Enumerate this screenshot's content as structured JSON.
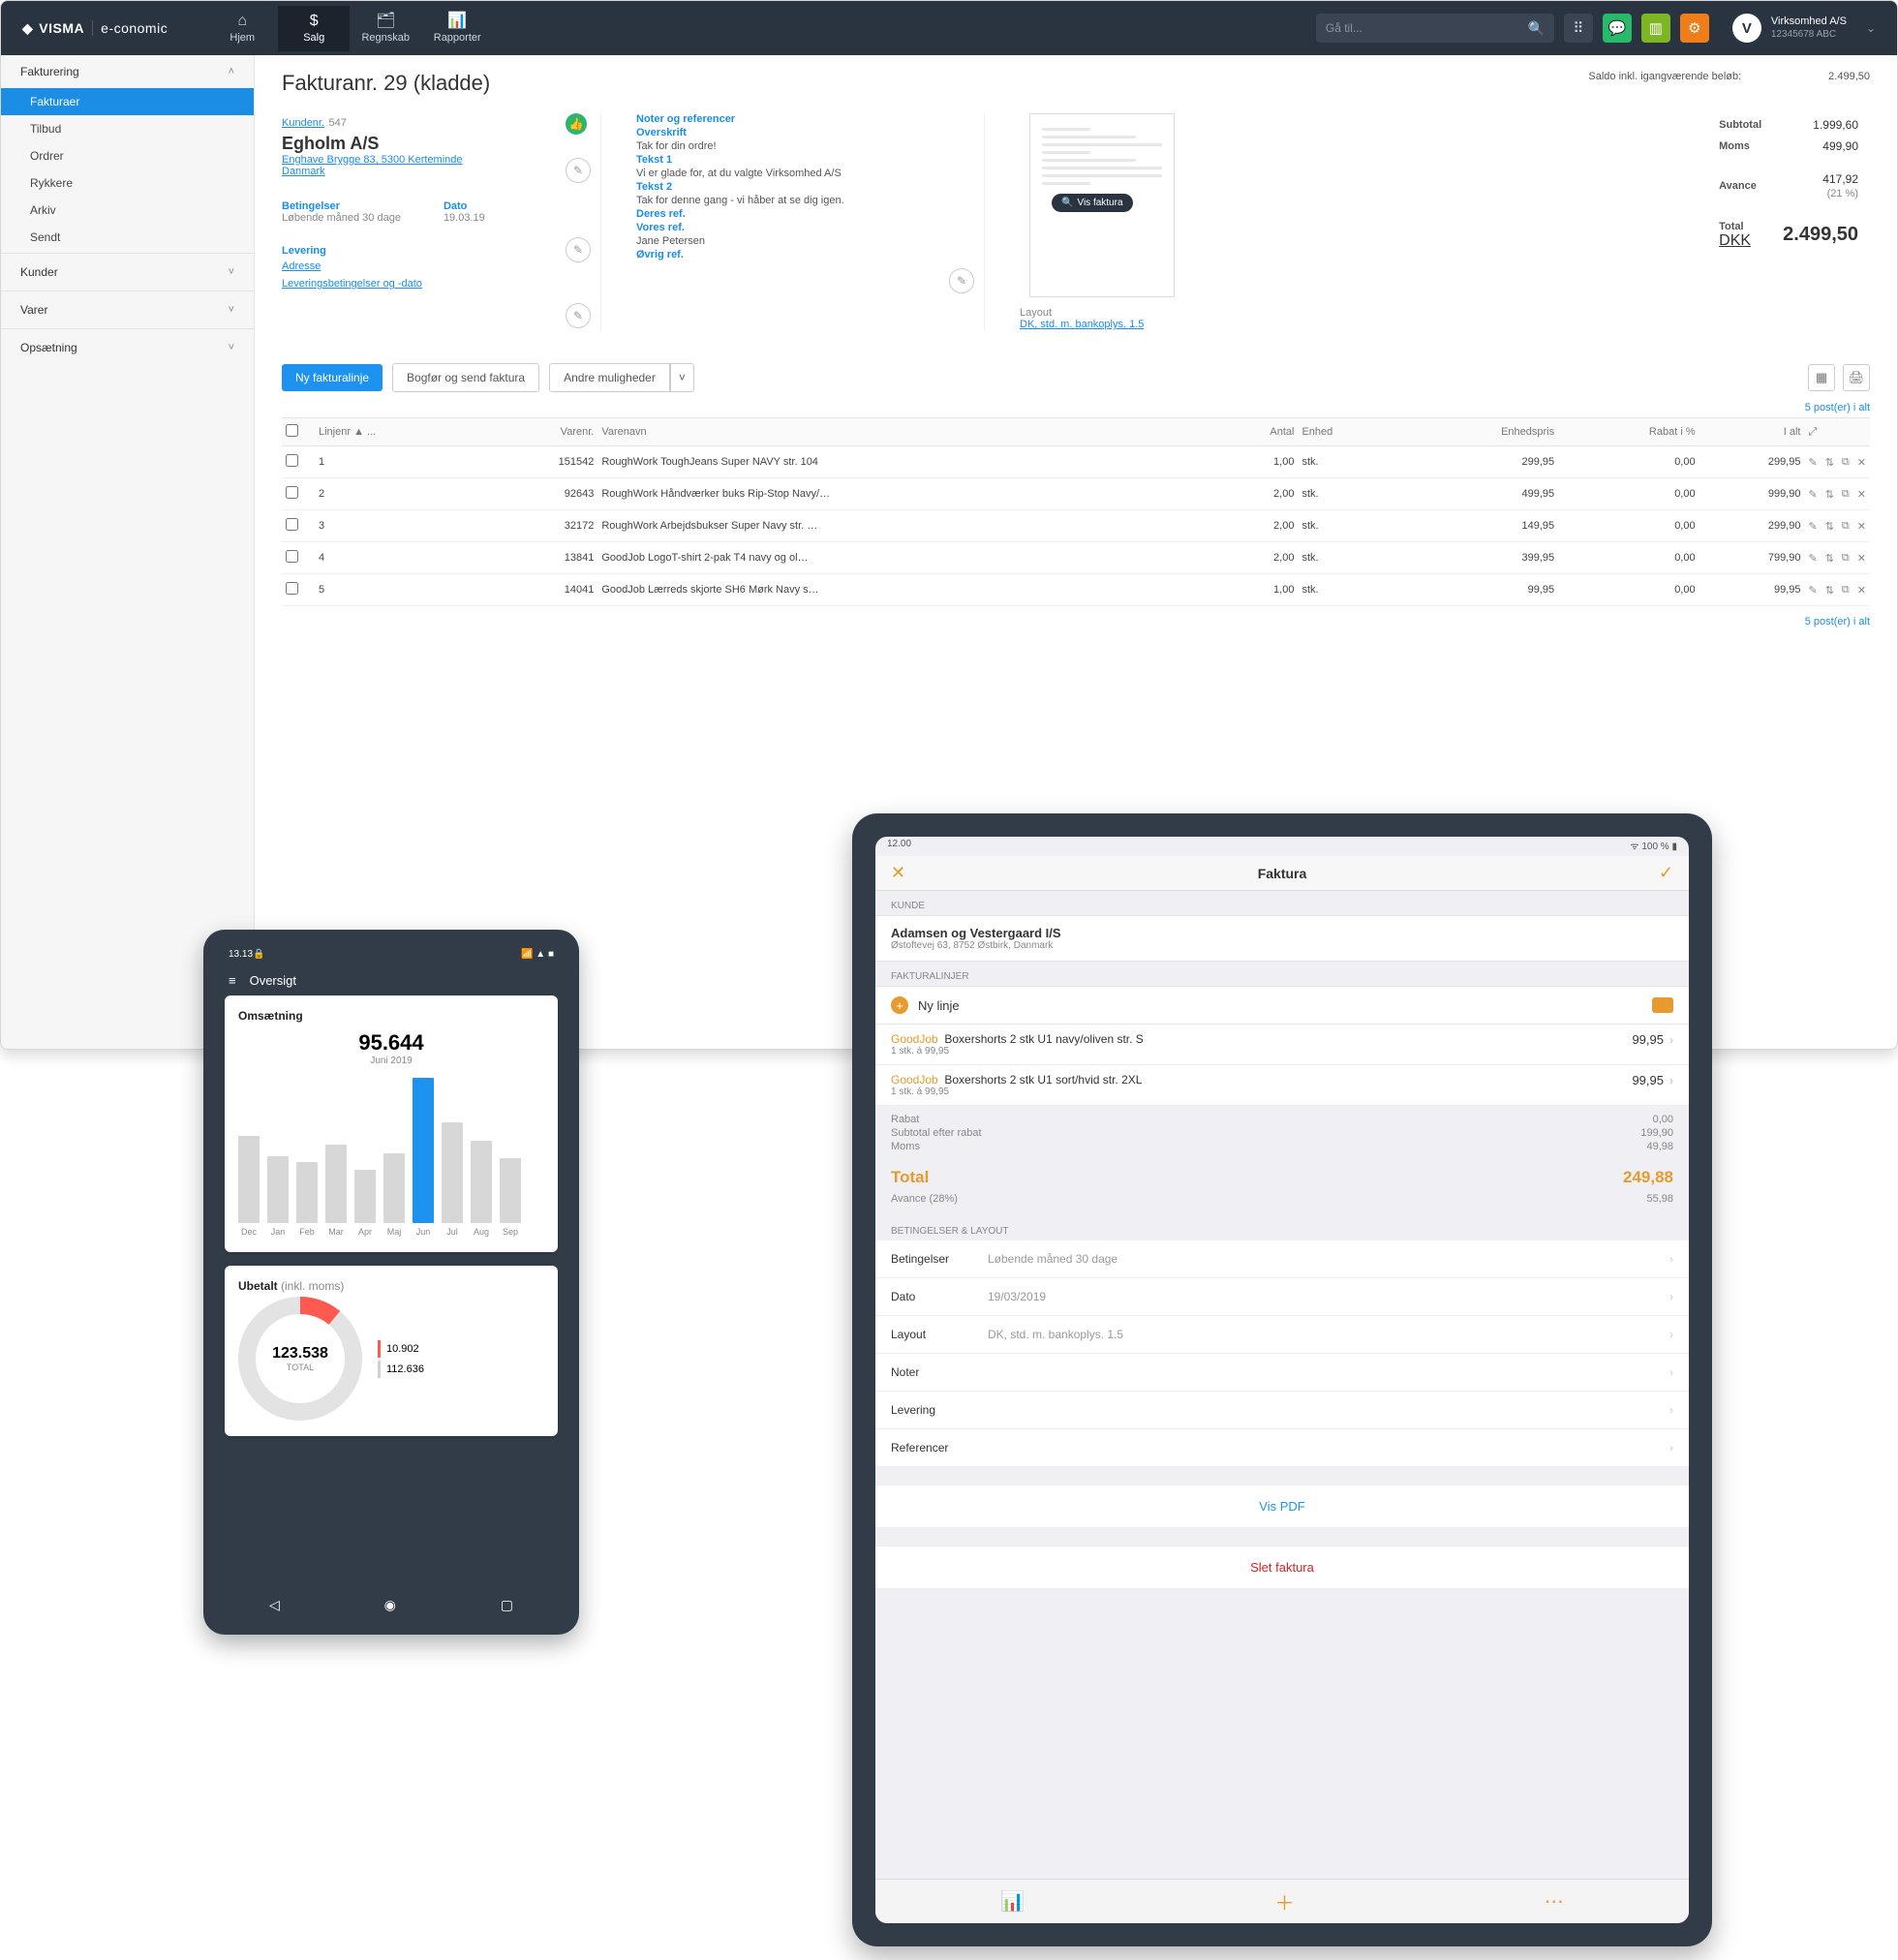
{
  "topbar": {
    "brand": "VISMA",
    "product": "e-conomic",
    "nav": [
      {
        "label": "Hjem",
        "icon": "⌂"
      },
      {
        "label": "Salg",
        "icon": "$"
      },
      {
        "label": "Regnskab",
        "icon": "🗂"
      },
      {
        "label": "Rapporter",
        "icon": "📊"
      }
    ],
    "search_placeholder": "Gå til...",
    "company_name": "Virksomhed A/S",
    "company_sub": "12345678 ABC"
  },
  "sidebar": {
    "group1_title": "Fakturering",
    "items1": [
      "Fakturaer",
      "Tilbud",
      "Ordrer",
      "Rykkere",
      "Arkiv",
      "Sendt"
    ],
    "collapsed": [
      "Kunder",
      "Varer",
      "Opsætning"
    ]
  },
  "page": {
    "title": "Fakturanr. 29 (kladde)",
    "balance_label": "Saldo inkl. igangværende beløb:",
    "balance_value": "2.499,50",
    "customer_label": "Kundenr.",
    "customer_no": "547",
    "customer_name": "Egholm A/S",
    "customer_addr": "Enghave Brygge 83, 5300 Kerteminde",
    "customer_country": "Danmark",
    "terms_label": "Betingelser",
    "terms_value": "Løbende måned 30 dage",
    "date_label": "Dato",
    "date_value": "19.03.19",
    "delivery_label": "Levering",
    "delivery_addr": "Adresse",
    "delivery_terms": "Leveringsbetingelser og -dato",
    "notes": {
      "header": "Noter og referencer",
      "overskrift": "Overskrift",
      "overskrift_txt": "Tak for din ordre!",
      "t1": "Tekst 1",
      "t1_txt": "Vi er glade for, at du valgte Virksomhed A/S",
      "t2": "Tekst 2",
      "t2_txt": "Tak for denne gang - vi håber at se dig igen.",
      "deres": "Deres ref.",
      "vores": "Vores ref.",
      "vores_txt": "Jane Petersen",
      "ovrig": "Øvrig ref."
    },
    "preview_btn": "Vis faktura",
    "layout_label": "Layout",
    "layout_value": "DK, std. m. bankoplys. 1.5",
    "totals": {
      "subtotal_l": "Subtotal",
      "subtotal_v": "1.999,60",
      "moms_l": "Moms",
      "moms_v": "499,90",
      "avance_l": "Avance",
      "avance_v": "417,92",
      "avance_pct": "(21 %)",
      "total_l": "Total",
      "ccy": "DKK",
      "total_v": "2.499,50"
    },
    "actions": {
      "new_line": "Ny fakturalinje",
      "book_send": "Bogfør og send faktura",
      "other": "Andre muligheder"
    },
    "count_text": "5 post(er) i alt",
    "columns": [
      "Linjenr ▲ ...",
      "Varenr.",
      "Varenavn",
      "Antal",
      "Enhed",
      "Enhedspris",
      "Rabat i %",
      "I alt"
    ],
    "rows": [
      {
        "n": "1",
        "item": "151542",
        "name": "RoughWork ToughJeans Super NAVY str. 104",
        "qty": "1,00",
        "unit": "stk.",
        "price": "299,95",
        "disc": "0,00",
        "total": "299,95"
      },
      {
        "n": "2",
        "item": "92643",
        "name": "RoughWork Håndværker buks Rip-Stop Navy/…",
        "qty": "2,00",
        "unit": "stk.",
        "price": "499,95",
        "disc": "0,00",
        "total": "999,90"
      },
      {
        "n": "3",
        "item": "32172",
        "name": "RoughWork Arbejdsbukser Super Navy str. …",
        "qty": "2,00",
        "unit": "stk.",
        "price": "149,95",
        "disc": "0,00",
        "total": "299,90"
      },
      {
        "n": "4",
        "item": "13841",
        "name": "GoodJob LogoT-shirt 2-pak T4 navy og ol…",
        "qty": "2,00",
        "unit": "stk.",
        "price": "399,95",
        "disc": "0,00",
        "total": "799,90"
      },
      {
        "n": "5",
        "item": "14041",
        "name": "GoodJob Lærreds skjorte SH6 Mørk Navy s…",
        "qty": "1,00",
        "unit": "stk.",
        "price": "99,95",
        "disc": "0,00",
        "total": "99,95"
      }
    ]
  },
  "phone": {
    "time": "13.13",
    "header": "Oversigt",
    "card1_title": "Omsætning",
    "revenue": "95.644",
    "revenue_sub": "Juni 2019",
    "months": [
      "Dec",
      "Jan",
      "Feb",
      "Mar",
      "Apr",
      "Maj",
      "Jun",
      "Jul",
      "Aug",
      "Sep"
    ],
    "card2_title": "Ubetalt",
    "card2_suffix": "(inkl. moms)",
    "total_big": "123.538",
    "total_sub": "TOTAL",
    "legend1": "10.902",
    "legend2": "112.636"
  },
  "tablet": {
    "time": "12.00",
    "battery": "100 %",
    "title": "Faktura",
    "kunde_label": "KUNDE",
    "kunde_name": "Adamsen og Vestergaard I/S",
    "kunde_addr": "Østoftevej 63, 8752 Østbirk, Danmark",
    "lines_label": "FAKTURALINJER",
    "new_line": "Ny linje",
    "lines": [
      {
        "brand": "GoodJob",
        "name": "Boxershorts 2 stk U1 navy/oliven str. S",
        "sub": "1 stk. á 99,95",
        "price": "99,95"
      },
      {
        "brand": "GoodJob",
        "name": "Boxershorts 2 stk U1 sort/hvid str. 2XL",
        "sub": "1 stk. á 99,95",
        "price": "99,95"
      }
    ],
    "rabat_l": "Rabat",
    "rabat_v": "0,00",
    "subrab_l": "Subtotal efter rabat",
    "subrab_v": "199,90",
    "moms_l": "Moms",
    "moms_v": "49,98",
    "total_l": "Total",
    "total_v": "249,88",
    "avance_l": "Avance (28%)",
    "avance_v": "55,98",
    "settings_label": "BETINGELSER & LAYOUT",
    "rows": [
      {
        "k": "Betingelser",
        "v": "Løbende måned 30 dage"
      },
      {
        "k": "Dato",
        "v": "19/03/2019"
      },
      {
        "k": "Layout",
        "v": "DK, std. m. bankoplys. 1.5"
      },
      {
        "k": "Noter",
        "v": ""
      },
      {
        "k": "Levering",
        "v": ""
      },
      {
        "k": "Referencer",
        "v": ""
      }
    ],
    "view_pdf": "Vis PDF",
    "delete": "Slet faktura"
  },
  "chart_data": {
    "type": "bar",
    "title": "Omsætning",
    "categories": [
      "Dec",
      "Jan",
      "Feb",
      "Mar",
      "Apr",
      "Maj",
      "Jun",
      "Jul",
      "Aug",
      "Sep"
    ],
    "values": [
      78,
      60,
      55,
      70,
      48,
      62,
      130,
      90,
      74,
      58
    ],
    "highlight_index": 6,
    "ylim": [
      0,
      150
    ]
  }
}
